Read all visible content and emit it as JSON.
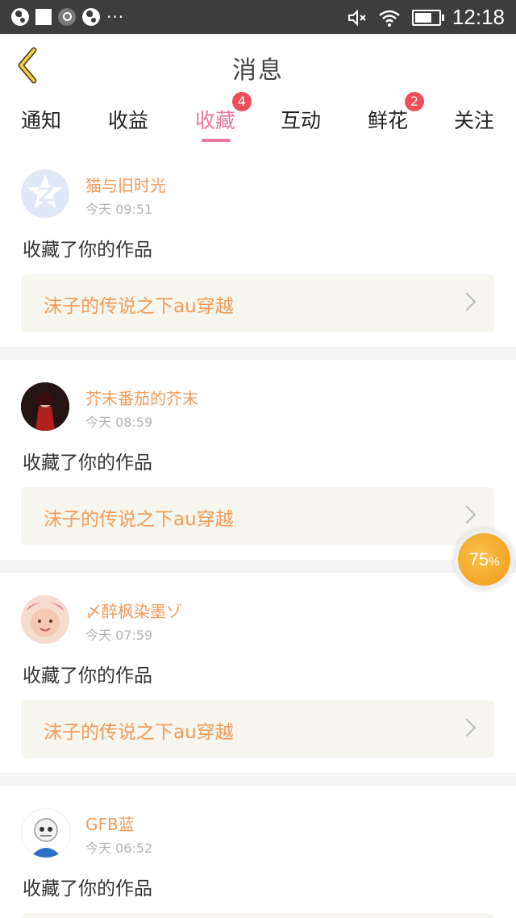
{
  "status_bar": {
    "time": "12:18",
    "battery_level": 0.7
  },
  "header": {
    "title": "消息",
    "back_icon": "chevron-left-icon"
  },
  "tabs": [
    {
      "label": "通知",
      "active": false,
      "badge": ""
    },
    {
      "label": "收益",
      "active": false,
      "badge": ""
    },
    {
      "label": "收藏",
      "active": true,
      "badge": "4"
    },
    {
      "label": "互动",
      "active": false,
      "badge": ""
    },
    {
      "label": "鲜花",
      "active": false,
      "badge": "2"
    },
    {
      "label": "关注",
      "active": false,
      "badge": ""
    }
  ],
  "messages": [
    {
      "user": "猫与旧时光",
      "time": "今天 09:51",
      "action": "收藏了你的作品",
      "work": "沫子的传说之下au穿越"
    },
    {
      "user": "芥末番茄的芥末",
      "time": "今天 08:59",
      "action": "收藏了你的作品",
      "work": "沫子的传说之下au穿越"
    },
    {
      "user": "〆醉枫染墨ゾ",
      "time": "今天 07:59",
      "action": "收藏了你的作品",
      "work": "沫子的传说之下au穿越"
    },
    {
      "user": "GFB蓝",
      "time": "今天 06:52",
      "action": "收藏了你的作品",
      "work": ""
    }
  ],
  "floating_progress": {
    "text": "75",
    "suffix": "%",
    "value": 0.75
  },
  "colors": {
    "accent": "#e9799c",
    "name": "#f29b5a",
    "badge": "#f04d5a",
    "work_bg": "#f6f5ee"
  }
}
